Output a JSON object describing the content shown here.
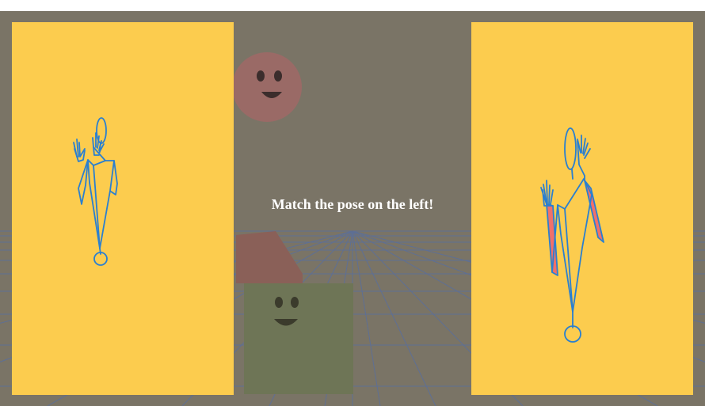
{
  "game": {
    "instruction": "Match the pose on the left!"
  },
  "colors": {
    "background": "#7a7466",
    "panel": "#fccc4e",
    "figure_stroke": "#2a7fd0",
    "mismatch_fill": "#f0706a",
    "floor_grid": "#5b6f9a",
    "pink_face": "#9a6a66",
    "green_cube": "#6e7556",
    "pink_cube": "#8a6058"
  },
  "icons": {
    "target_figure": "stick-figure-target-icon",
    "player_figure": "stick-figure-player-icon",
    "pink_character": "smiley-face-icon",
    "green_character": "smiley-cube-icon"
  }
}
